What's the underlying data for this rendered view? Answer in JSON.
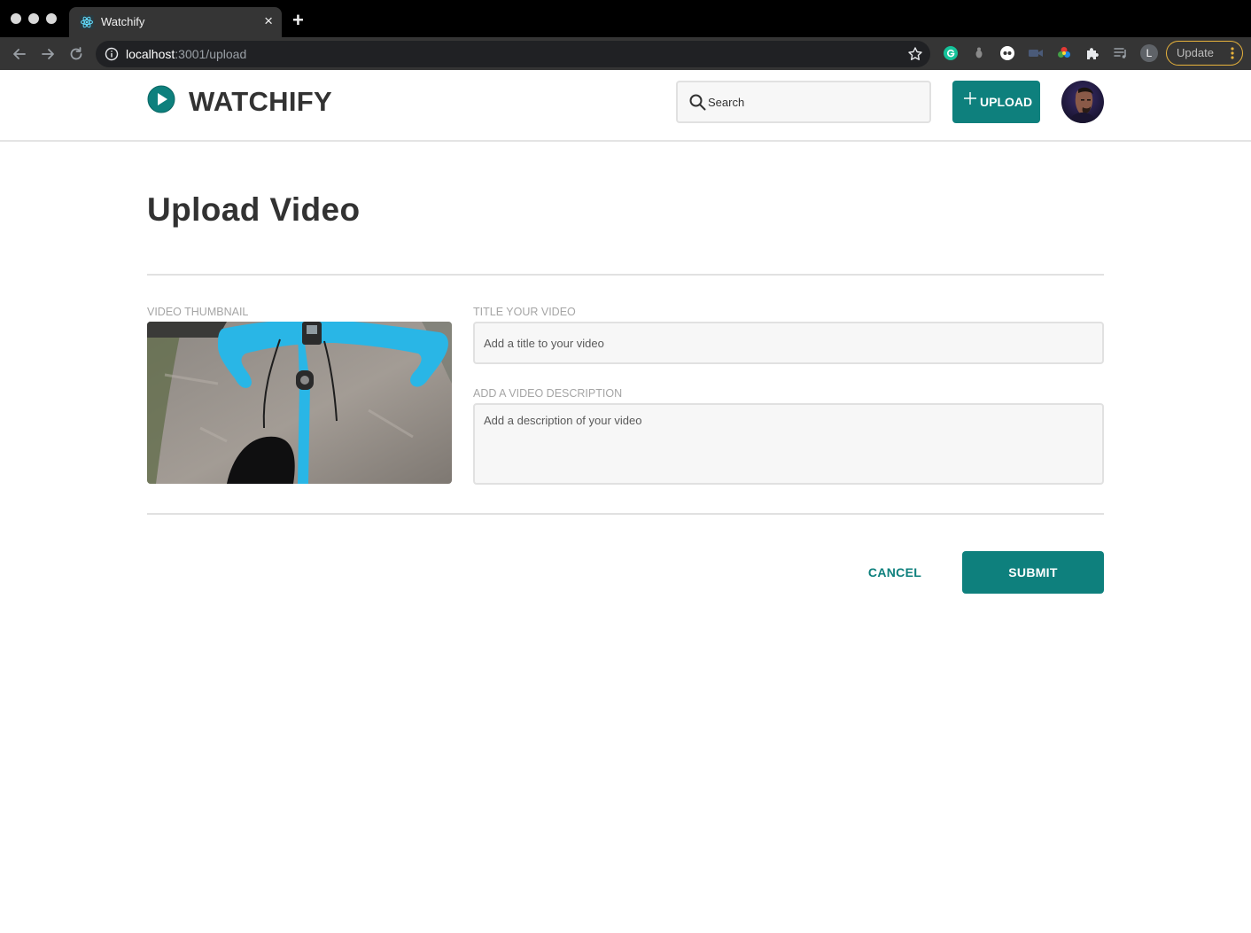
{
  "browser": {
    "tab_title": "Watchify",
    "new_tab_symbol": "+",
    "close_symbol": "×",
    "url_host": "localhost",
    "url_rest": ":3001/upload",
    "profile_initial": "L",
    "update_label": "Update"
  },
  "header": {
    "logo_text": "WATCHIFY",
    "search_placeholder": "Search",
    "upload_label": "UPLOAD"
  },
  "page": {
    "title": "Upload Video"
  },
  "form": {
    "thumbnail_label": "VIDEO THUMBNAIL",
    "title_label": "TITLE YOUR VIDEO",
    "title_placeholder": "Add a title to your video",
    "title_value": "",
    "description_label": "ADD A VIDEO DESCRIPTION",
    "description_placeholder": "Add a description of your video",
    "description_value": "",
    "cancel_label": "CANCEL",
    "submit_label": "SUBMIT"
  },
  "colors": {
    "accent": "#0e807d",
    "text": "#323232",
    "label": "#a5a5a5",
    "field_bg": "#f7f7f7",
    "border": "#e1e1e1"
  }
}
